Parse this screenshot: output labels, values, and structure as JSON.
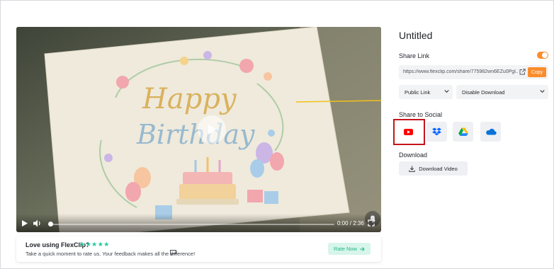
{
  "project": {
    "title": "Untitled"
  },
  "video": {
    "time": "0:00 / 2:36",
    "progress_fraction": 0.0,
    "card_text_line1": "Happy",
    "card_text_line2": "Birthday"
  },
  "rating": {
    "title": "Love using FlexClip?",
    "stars": "★★★★★",
    "subtitle": "Take a quick moment to rate us. Your feedback makes all the difference!",
    "button_label": "Rate Now"
  },
  "share_link": {
    "label": "Share Link",
    "enabled": true,
    "url": "https://www.flexclip.com/share/775982wn6EZu0Pgl...",
    "copy_label": "Copy",
    "visibility": "Public Link",
    "download_setting": "Disable Download"
  },
  "share_social": {
    "label": "Share to Social",
    "platforms": [
      "youtube-icon",
      "dropbox-icon",
      "google-drive-icon",
      "onedrive-icon"
    ],
    "highlighted": "youtube-icon"
  },
  "download": {
    "label": "Download",
    "button_label": "Download Video"
  },
  "colors": {
    "accent": "#fa8c2b",
    "highlight_border": "#c4161c",
    "rating_green": "#20c997",
    "youtube_red": "#ff0000"
  }
}
